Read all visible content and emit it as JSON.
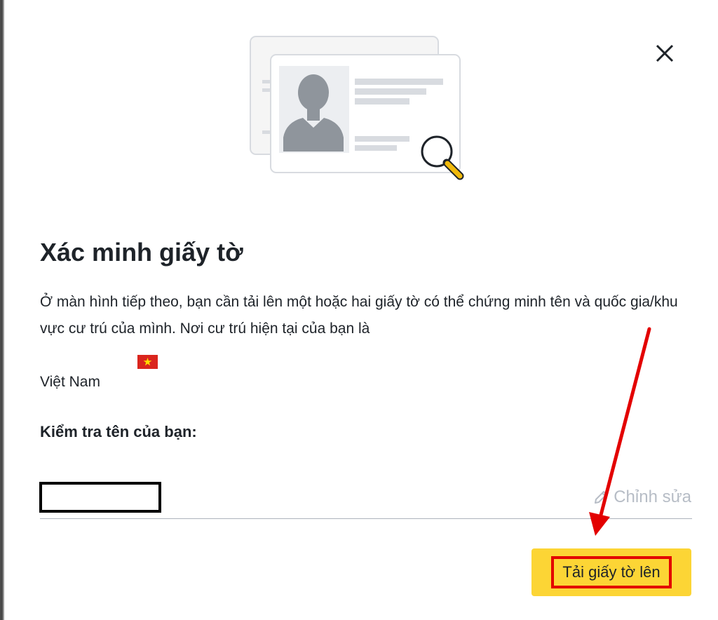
{
  "dialog": {
    "title": "Xác minh giấy tờ",
    "description": "Ở màn hình tiếp theo, bạn cần tải lên một hoặc hai giấy tờ có thể chứng minh tên và quốc gia/khu vực cư trú của mình. Nơi cư trú hiện tại của bạn là",
    "country": "Việt Nam",
    "country_flag_icon": "vietnam-flag-icon",
    "name_section_label": "Kiểm tra tên của bạn:",
    "edit_label": "Chỉnh sửa",
    "upload_button_label": "Tải giấy tờ lên",
    "close_icon": "close-icon"
  },
  "colors": {
    "accent_yellow": "#fcd535",
    "annotation_red": "#e30000",
    "text_primary": "#1e2329",
    "text_disabled": "#b7bdc6"
  }
}
